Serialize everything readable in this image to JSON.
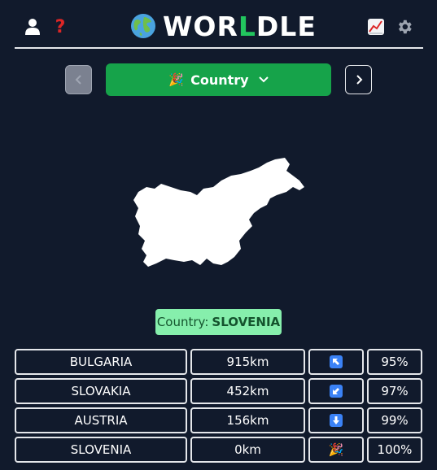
{
  "header": {
    "logo_prefix": "WOR",
    "logo_accent": "L",
    "logo_suffix": "DLE",
    "left_icons": [
      "user-icon",
      "help-icon"
    ],
    "right_icons": [
      "stats-chart-icon",
      "gear-icon"
    ],
    "help_glyph": "?"
  },
  "mode": {
    "label": "Country",
    "icon": "party-popper-icon",
    "prev_glyph": "‹",
    "next_glyph": "›"
  },
  "answer": {
    "prefix": "Country:",
    "name": "SLOVENIA"
  },
  "guesses": [
    {
      "country": "BULGARIA",
      "distance": "915km",
      "direction": "arrow-up-left-icon",
      "proximity": "95%"
    },
    {
      "country": "SLOVAKIA",
      "distance": "452km",
      "direction": "arrow-down-left-icon",
      "proximity": "97%"
    },
    {
      "country": "AUSTRIA",
      "distance": "156km",
      "direction": "arrow-down-icon",
      "proximity": "99%"
    },
    {
      "country": "SLOVENIA",
      "distance": "0km",
      "direction": "party-popper-icon",
      "proximity": "100%"
    }
  ],
  "colors": {
    "background": "#111a2c",
    "accent_green": "#16a34a",
    "answer_bg": "#86efac",
    "help_red": "#dc2626",
    "arrow_blue": "#3b82f6"
  }
}
